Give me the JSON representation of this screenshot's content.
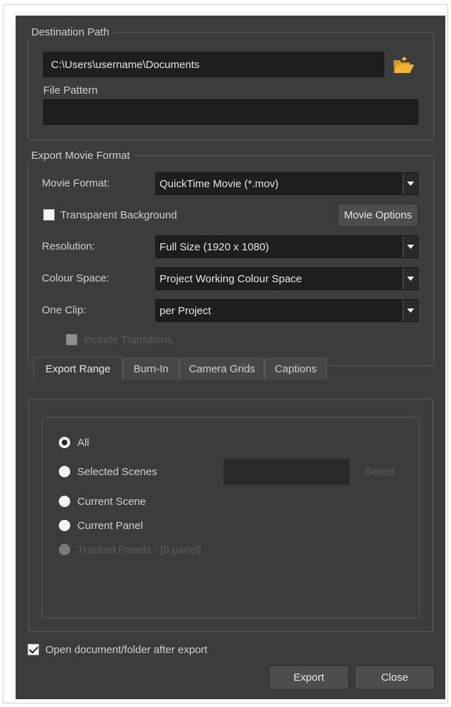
{
  "destination": {
    "group_title": "Destination Path",
    "path_value": "C:\\Users\\username\\Documents",
    "folder_icon": "folder-open-icon",
    "file_pattern_label": "File Pattern",
    "file_pattern_value": ""
  },
  "export_format": {
    "group_title": "Export Movie Format",
    "movie_format_label": "Movie Format:",
    "movie_format_value": "QuickTime Movie (*.mov)",
    "transparent_bg_label": "Transparent Background",
    "transparent_bg_checked": false,
    "movie_options_button": "Movie Options",
    "resolution_label": "Resolution:",
    "resolution_value": "Full Size (1920 x 1080)",
    "colour_space_label": "Colour Space:",
    "colour_space_value": "Project Working Colour Space",
    "one_clip_label": "One Clip:",
    "one_clip_value": "per Project",
    "include_transitions_label": "Include Transitions",
    "include_transitions_enabled": false
  },
  "tabs": [
    {
      "label": "Export Range",
      "active": true
    },
    {
      "label": "Burn-In",
      "active": false
    },
    {
      "label": "Camera Grids",
      "active": false
    },
    {
      "label": "Captions",
      "active": false
    }
  ],
  "export_range": {
    "options": [
      {
        "label": "All",
        "checked": true,
        "enabled": true
      },
      {
        "label": "Selected Scenes",
        "checked": false,
        "enabled": true
      },
      {
        "label": "Current Scene",
        "checked": false,
        "enabled": true
      },
      {
        "label": "Current Panel",
        "checked": false,
        "enabled": true
      },
      {
        "label": "Tracked Panels - [0 panel]",
        "checked": false,
        "enabled": false
      }
    ],
    "selected_scenes_value": "",
    "select_button": "Select"
  },
  "footer": {
    "open_after_export_label": "Open document/folder after export",
    "open_after_export_checked": true,
    "export_button": "Export",
    "close_button": "Close"
  },
  "colors": {
    "dialog_bg": "#3c3c3c",
    "field_bg": "#1e1e1e",
    "folder_icon": "#f2b234"
  }
}
